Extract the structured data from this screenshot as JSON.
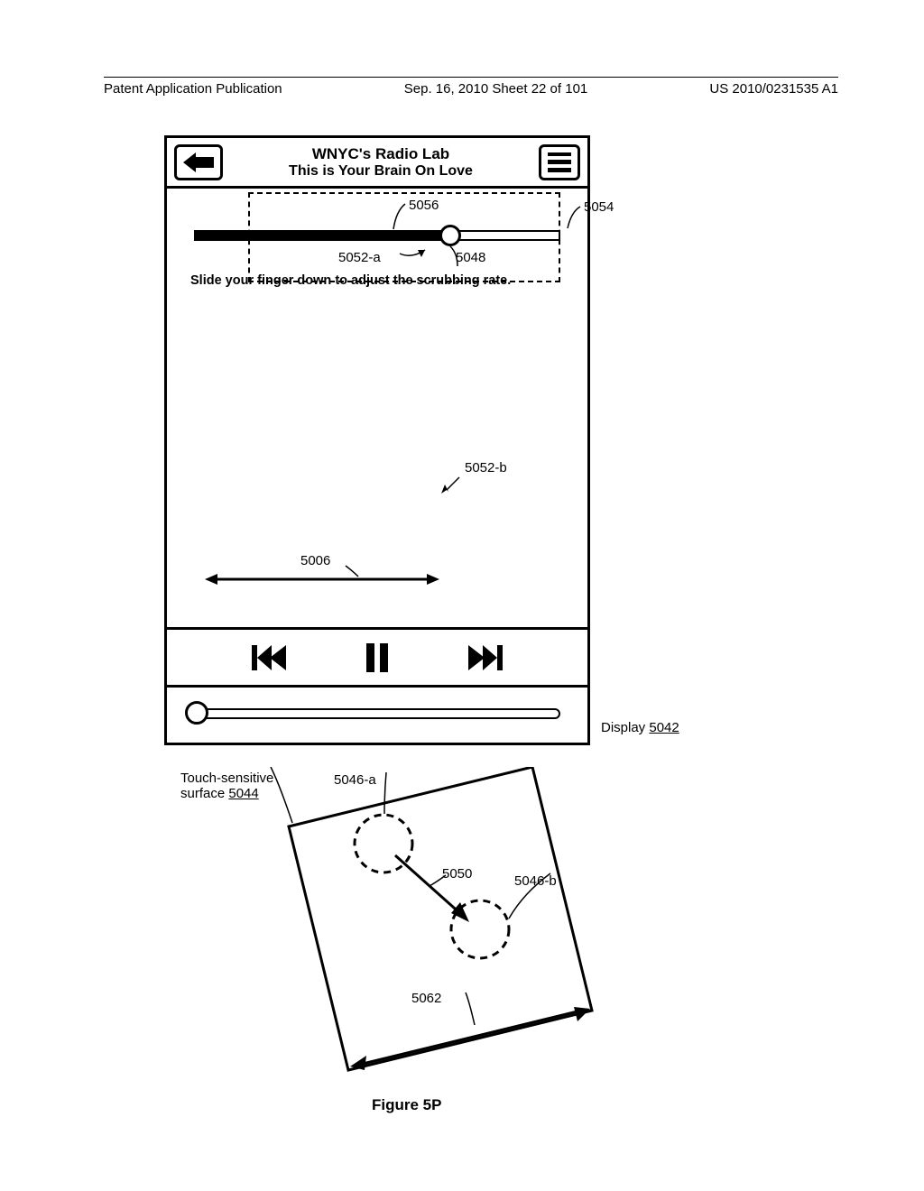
{
  "header": {
    "left": "Patent Application Publication",
    "center": "Sep. 16, 2010  Sheet 22 of 101",
    "right": "US 2010/0231535 A1"
  },
  "player": {
    "title1": "WNYC's Radio Lab",
    "title2": "This is Your Brain On Love",
    "hint": "Slide your finger down to adjust the scrubbing rate."
  },
  "refs": {
    "r5056": "5056",
    "r5054": "5054",
    "r5052a": "5052-a",
    "r5048": "5048",
    "r5052b": "5052-b",
    "r5006": "5006",
    "r5042_label": "Display ",
    "r5042": "5042",
    "r5044_label": "Touch-sensitive",
    "r5044_label2": "surface ",
    "r5044": "5044",
    "r5046a": "5046-a",
    "r5050": "5050",
    "r5046b": "5046-b",
    "r5062": "5062"
  },
  "figure": "Figure 5P"
}
